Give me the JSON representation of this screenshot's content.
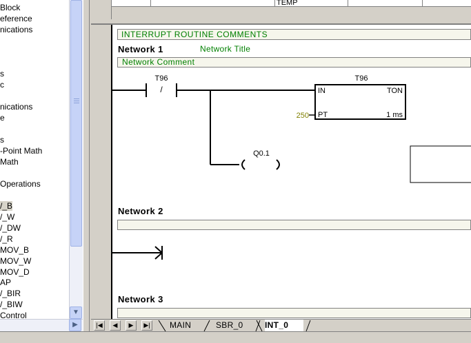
{
  "tree": {
    "items": [
      {
        "label": "Block",
        "selected": false
      },
      {
        "label": "eference",
        "selected": false
      },
      {
        "label": "nications",
        "selected": false
      },
      {
        "label": "s",
        "selected": false
      },
      {
        "label": "c",
        "selected": false
      },
      {
        "label": "nications",
        "selected": false
      },
      {
        "label": "e",
        "selected": false
      },
      {
        "label": "s",
        "selected": false
      },
      {
        "label": "-Point Math",
        "selected": false
      },
      {
        "label": "Math",
        "selected": false
      },
      {
        "label": "Operations",
        "selected": false
      },
      {
        "label": "/_B",
        "selected": true
      },
      {
        "label": "/_W",
        "selected": false
      },
      {
        "label": "/_DW",
        "selected": false
      },
      {
        "label": "/_R",
        "selected": false
      },
      {
        "label": "MOV_B",
        "selected": false
      },
      {
        "label": "MOV_W",
        "selected": false
      },
      {
        "label": "MOV_D",
        "selected": false
      },
      {
        "label": "AP",
        "selected": false
      },
      {
        "label": "/_BIR",
        "selected": false
      },
      {
        "label": "/_BIW",
        "selected": false
      },
      {
        "label": " Control",
        "selected": false
      }
    ]
  },
  "var_table": {
    "cell_text": "TEMP"
  },
  "editor": {
    "routine_comment": "INTERRUPT ROUTINE COMMENTS",
    "networks": [
      {
        "label": "Network 1",
        "title": "Network Title",
        "comment": "Network Comment"
      },
      {
        "label": "Network 2",
        "title": "",
        "comment": ""
      },
      {
        "label": "Network 3",
        "title": "",
        "comment": ""
      }
    ],
    "contact": {
      "operand": "T96",
      "symbol": "/"
    },
    "timer": {
      "name": "T96",
      "type": "TON",
      "in_label": "IN",
      "pt_label": "PT",
      "pt_value": "250",
      "resolution": "1 ms"
    },
    "coil": {
      "operand": "Q0.1"
    }
  },
  "tabs": {
    "nav": [
      "|◀",
      "◀",
      "▶",
      "▶|"
    ],
    "items": [
      {
        "label": "MAIN",
        "active": false
      },
      {
        "label": "SBR_0",
        "active": false
      },
      {
        "label": "INT_0",
        "active": true
      }
    ]
  },
  "colors": {
    "comment_text": "#008000",
    "pt_value": "#808000",
    "selection_bg": "#d7d4c9",
    "scrollbar_thumb": "#c6d3f7"
  }
}
